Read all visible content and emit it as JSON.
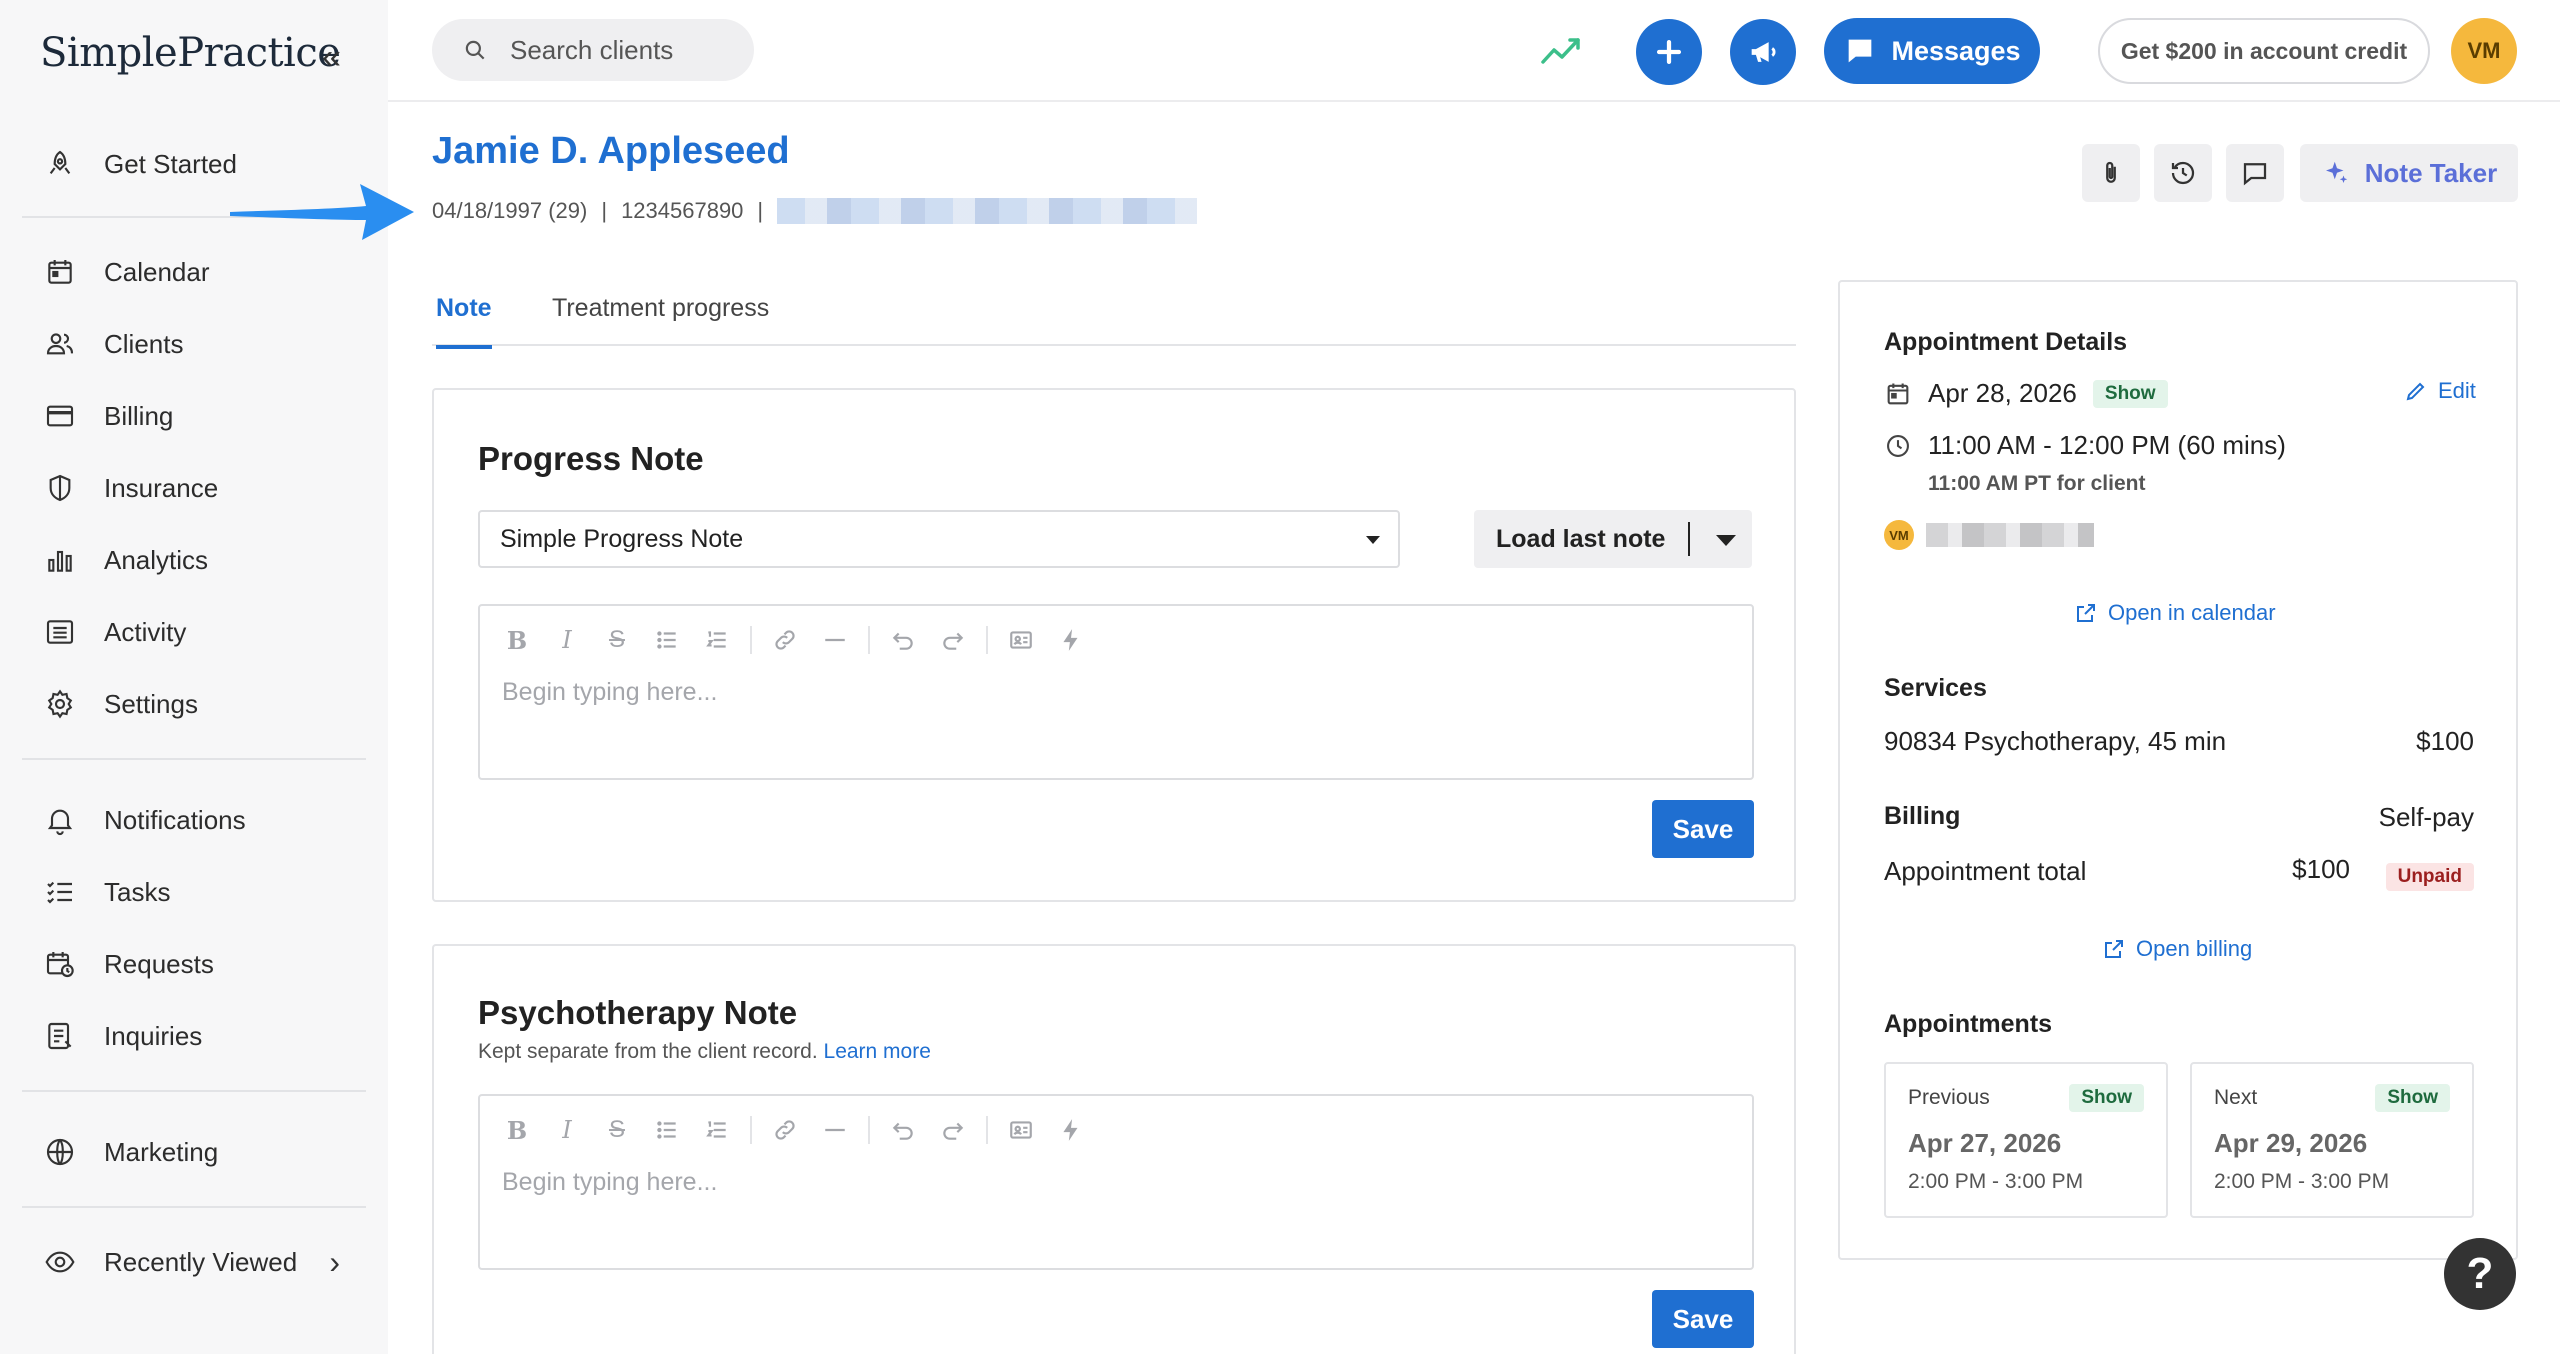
{
  "app": {
    "logo": "SimplePractice"
  },
  "sidebar": {
    "items": [
      {
        "label": "Get Started"
      },
      {
        "label": "Calendar"
      },
      {
        "label": "Clients"
      },
      {
        "label": "Billing"
      },
      {
        "label": "Insurance"
      },
      {
        "label": "Analytics"
      },
      {
        "label": "Activity"
      },
      {
        "label": "Settings"
      },
      {
        "label": "Notifications"
      },
      {
        "label": "Tasks"
      },
      {
        "label": "Requests"
      },
      {
        "label": "Inquiries"
      },
      {
        "label": "Marketing"
      },
      {
        "label": "Recently Viewed"
      }
    ]
  },
  "topbar": {
    "search_placeholder": "Search clients",
    "messages_label": "Messages",
    "credit_label": "Get $200 in account credit",
    "avatar_initials": "VM"
  },
  "client": {
    "name": "Jamie D. Appleseed",
    "dob": "04/18/1997 (29)",
    "phone": "1234567890",
    "sep": "|"
  },
  "header_actions": {
    "note_taker_label": "Note Taker"
  },
  "tabs": [
    {
      "label": "Note",
      "active": true
    },
    {
      "label": "Treatment progress",
      "active": false
    }
  ],
  "progress_note": {
    "title": "Progress Note",
    "template": "Simple Progress Note",
    "load_last_label": "Load last note",
    "placeholder": "Begin typing here...",
    "save_label": "Save"
  },
  "psychotherapy_note": {
    "title": "Psychotherapy Note",
    "subtext": "Kept separate from the client record.",
    "learn_more": "Learn more",
    "placeholder": "Begin typing here...",
    "save_label": "Save"
  },
  "appointment": {
    "heading": "Appointment Details",
    "date": "Apr 28, 2026",
    "status": "Show",
    "edit_label": "Edit",
    "time": "11:00 AM - 12:00 PM (60 mins)",
    "client_time": "11:00 AM PT for client",
    "clinician_initials": "VM",
    "open_calendar": "Open in calendar",
    "services_heading": "Services",
    "service": "90834 Psychotherapy, 45 min",
    "service_price": "$100",
    "billing_heading": "Billing",
    "billing_type": "Self-pay",
    "total_label": "Appointment total",
    "total_amount": "$100",
    "payment_status": "Unpaid",
    "open_billing": "Open billing",
    "appointments_heading": "Appointments",
    "previous": {
      "label": "Previous",
      "status": "Show",
      "date": "Apr 27, 2026",
      "time": "2:00 PM - 3:00 PM"
    },
    "next": {
      "label": "Next",
      "status": "Show",
      "date": "Apr 29, 2026",
      "time": "2:00 PM - 3:00 PM"
    }
  },
  "help_label": "?",
  "colors": {
    "accent": "#1f6fd1",
    "sidebar_bg": "#f7f7f8",
    "avatar": "#f5b83d",
    "trend": "#3cbf8a",
    "note_taker": "#5b6fd8"
  }
}
